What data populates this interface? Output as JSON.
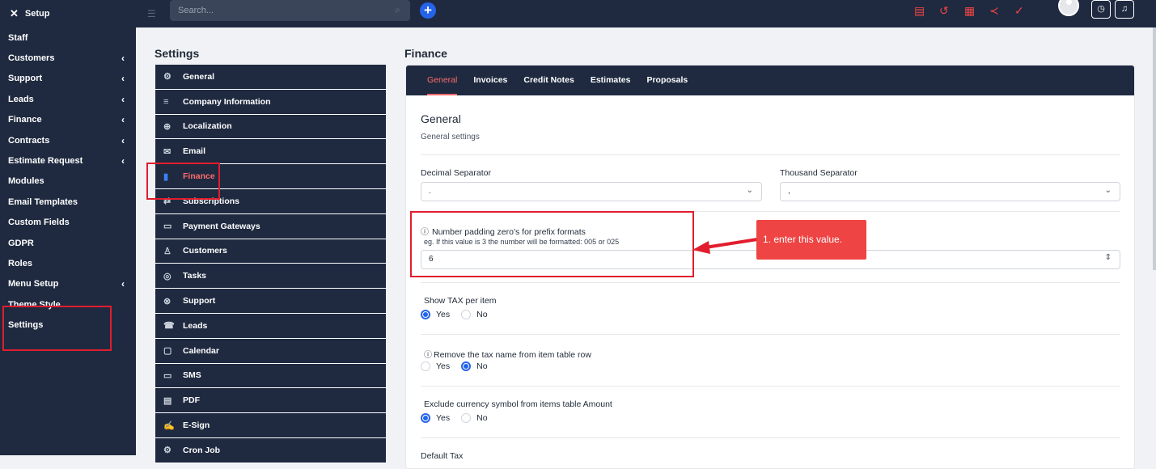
{
  "sidebar": {
    "header": "Setup",
    "items": [
      {
        "label": "Staff",
        "chevron": false
      },
      {
        "label": "Customers",
        "chevron": true
      },
      {
        "label": "Support",
        "chevron": true
      },
      {
        "label": "Leads",
        "chevron": true
      },
      {
        "label": "Finance",
        "chevron": true
      },
      {
        "label": "Contracts",
        "chevron": true
      },
      {
        "label": "Estimate Request",
        "chevron": true
      },
      {
        "label": "Modules",
        "chevron": false
      },
      {
        "label": "Email Templates",
        "chevron": false
      },
      {
        "label": "Custom Fields",
        "chevron": false
      },
      {
        "label": "GDPR",
        "chevron": false
      },
      {
        "label": "Roles",
        "chevron": false
      },
      {
        "label": "Menu Setup",
        "chevron": true
      },
      {
        "label": "Theme Style",
        "chevron": false
      },
      {
        "label": "Settings",
        "chevron": false
      }
    ]
  },
  "topbar": {
    "search_placeholder": "Search...",
    "plus": "+"
  },
  "settings": {
    "title": "Settings",
    "menu": [
      {
        "label": "General",
        "icon": "⚙"
      },
      {
        "label": "Company Information",
        "icon": "≡"
      },
      {
        "label": "Localization",
        "icon": "⊕"
      },
      {
        "label": "Email",
        "icon": "✉"
      },
      {
        "label": "Finance",
        "icon": "▮"
      },
      {
        "label": "Subscriptions",
        "icon": "⇄"
      },
      {
        "label": "Payment Gateways",
        "icon": "▭"
      },
      {
        "label": "Customers",
        "icon": "♙"
      },
      {
        "label": "Tasks",
        "icon": "◎"
      },
      {
        "label": "Support",
        "icon": "⊗"
      },
      {
        "label": "Leads",
        "icon": "☎"
      },
      {
        "label": "Calendar",
        "icon": "▢"
      },
      {
        "label": "SMS",
        "icon": "▭"
      },
      {
        "label": "PDF",
        "icon": "▤"
      },
      {
        "label": "E-Sign",
        "icon": "✍"
      },
      {
        "label": "Cron Job",
        "icon": "⚙"
      }
    ]
  },
  "finance": {
    "title": "Finance",
    "tabs": [
      "General",
      "Invoices",
      "Credit Notes",
      "Estimates",
      "Proposals"
    ],
    "section_title": "General",
    "section_sub": "General settings",
    "decimal_label": "Decimal Separator",
    "decimal_value": ".",
    "thousand_label": "Thousand Separator",
    "thousand_value": ",",
    "padding_label": "Number padding zero's for prefix formats",
    "padding_hint": "eg. If this value is 3 the number will be formatted: 005 or 025",
    "padding_value": "6",
    "show_tax_label": "Show TAX per item",
    "remove_tax_label": "Remove the tax name from item table row",
    "exclude_currency_label": "Exclude currency symbol from items table Amount",
    "default_tax_label": "Default Tax",
    "yes": "Yes",
    "no": "No"
  },
  "annotation": {
    "callout": "1. enter this value."
  },
  "colors": {
    "sidebar": "#1f2a40",
    "accent": "#ef4444",
    "primary": "#2563eb"
  }
}
